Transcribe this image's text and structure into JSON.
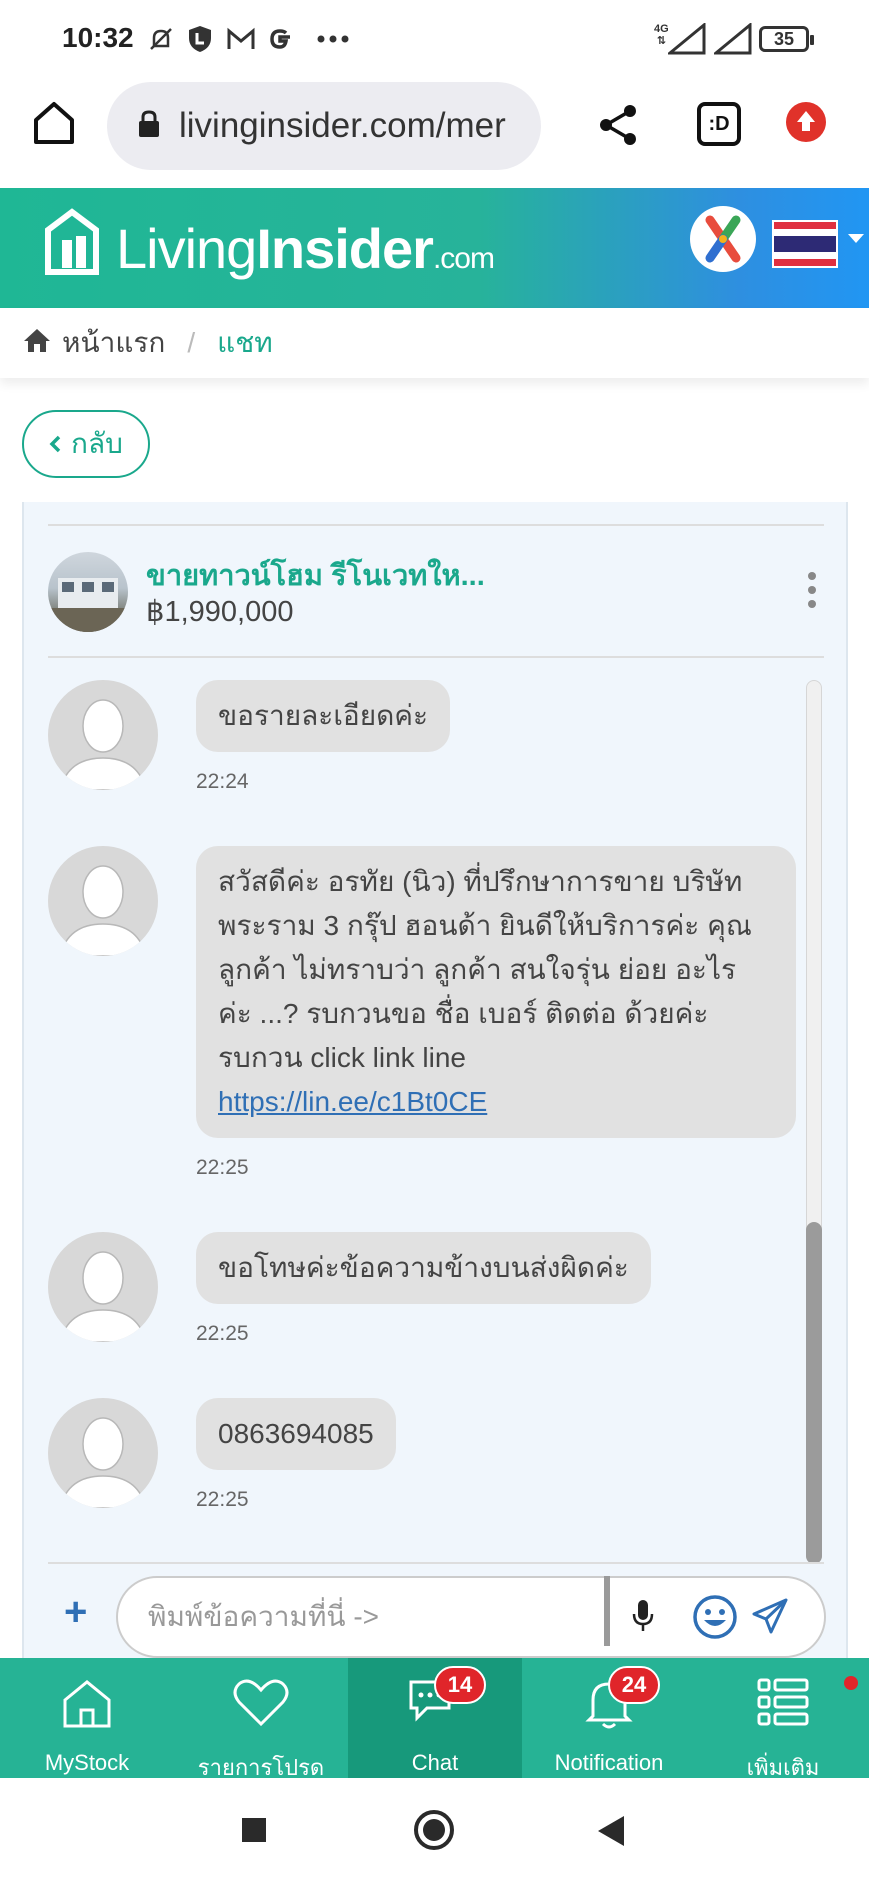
{
  "status_bar": {
    "time": "10:32",
    "network": "4G",
    "battery": "35"
  },
  "browser": {
    "url": "livinginsider.com/mer",
    "tab_switch_label": ":D"
  },
  "site": {
    "logo_light": "Living",
    "logo_bold": "Insider",
    "logo_domain": ".com"
  },
  "breadcrumb": {
    "home": "หน้าแรก",
    "separator": "/",
    "current": "แชท"
  },
  "back_label": "กลับ",
  "listing": {
    "title": "ขายทาวน์โฮม รีโนเวทให...",
    "price": "฿1,990,000"
  },
  "messages": [
    {
      "text": "ขอรายละเอียดค่ะ",
      "time": "22:24"
    },
    {
      "lines": [
        "สวัสดีค่ะ อรทัย (นิว) ที่ปรึกษาการขาย บริษัท",
        "พระราม 3 กรุ๊ป ฮอนด้า ยินดีให้บริการค่ะ  คุณ",
        "ลูกค้า ไม่ทราบว่า ลูกค้า สนใจรุ่น ย่อย อะไร",
        "ค่ะ ...?  รบกวนขอ ชื่อ เบอร์ ติดต่อ ด้วยค่ะ",
        "รบกวน click link line"
      ],
      "link": "https://lin.ee/c1Bt0CE",
      "time": "22:25"
    },
    {
      "text": "ขอโทษค่ะข้อความข้างบนส่งผิดค่ะ",
      "time": "22:25"
    },
    {
      "text": "0863694085",
      "time": "22:25"
    }
  ],
  "composer": {
    "placeholder": "พิมพ์ข้อความที่นี่ ->"
  },
  "bottom_nav": [
    {
      "label": "MyStock"
    },
    {
      "label": "รายการโปรด"
    },
    {
      "label": "Chat",
      "badge": "14"
    },
    {
      "label": "Notification",
      "badge": "24"
    },
    {
      "label": "เพิ่มเติม"
    }
  ],
  "colors": {
    "brand": "#26b395",
    "accent": "#1aa88c",
    "badge": "#e0252a",
    "link": "#2f6fb5"
  }
}
